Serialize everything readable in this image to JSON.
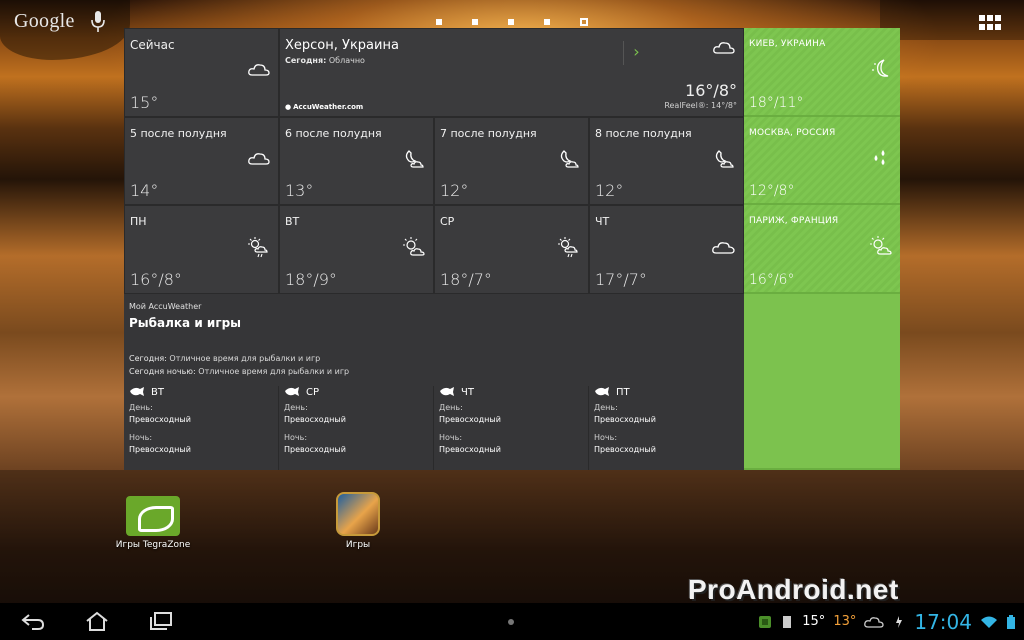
{
  "top_bar": {
    "search_logo": "Google",
    "page_count": 5,
    "active_page": 5
  },
  "colors": {
    "tile_dark": "#3b3b3d",
    "tile_green": "#7cc24e",
    "clock_blue": "#33b5e5",
    "tray_temp_orange": "#f2a03a"
  },
  "current": {
    "label": "Сейчас",
    "temp": "15°",
    "icon": "cloud-icon",
    "city": "Херсон, Украина",
    "today_label": "Сегодня:",
    "today_condition": "Облачно",
    "brand": "AccuWeather.com",
    "hi_lo": "16°/8°",
    "realfeel": "RealFeel®: 14°/8°",
    "arrow": "›"
  },
  "cities": [
    {
      "name": "КИЕВ, УКРАИНА",
      "temp": "18°/11°",
      "icon": "moon-icon"
    },
    {
      "name": "МОСКВА, РОССИЯ",
      "temp": "12°/8°",
      "icon": "rain-drops-icon"
    },
    {
      "name": "ПАРИЖ, ФРАНЦИЯ",
      "temp": "16°/6°",
      "icon": "partly-sunny-icon"
    }
  ],
  "hourly": [
    {
      "label": "5 после полудня",
      "temp": "14°",
      "icon": "cloud-icon"
    },
    {
      "label": "6 после полудня",
      "temp": "13°",
      "icon": "moon-cloud-icon"
    },
    {
      "label": "7 после полудня",
      "temp": "12°",
      "icon": "moon-cloud-icon"
    },
    {
      "label": "8 после полудня",
      "temp": "12°",
      "icon": "moon-cloud-icon"
    }
  ],
  "daily": [
    {
      "label": "ПН",
      "temp": "16°/8°",
      "icon": "sun-cloud-rain-icon"
    },
    {
      "label": "ВТ",
      "temp": "18°/9°",
      "icon": "sun-cloud-icon"
    },
    {
      "label": "СР",
      "temp": "18°/7°",
      "icon": "sun-cloud-rain-icon"
    },
    {
      "label": "ЧТ",
      "temp": "17°/7°",
      "icon": "cloud-icon"
    }
  ],
  "my_accu": {
    "subtitle": "Мой AccuWeather",
    "title": "Рыбалка и игры",
    "today_label": "Сегодня:",
    "today_text": "Отличное время для рыбалки и игр",
    "tonight_label": "Сегодня ночью:",
    "tonight_text": "Отличное время для рыбалки и игр",
    "days": [
      {
        "day": "ВТ",
        "day_label": "День:",
        "day_value": "Превосходный",
        "night_label": "Ночь:",
        "night_value": "Превосходный"
      },
      {
        "day": "СР",
        "day_label": "День:",
        "day_value": "Превосходный",
        "night_label": "Ночь:",
        "night_value": "Превосходный"
      },
      {
        "day": "ЧТ",
        "day_label": "День:",
        "day_value": "Превосходный",
        "night_label": "Ночь:",
        "night_value": "Превосходный"
      },
      {
        "day": "ПТ",
        "day_label": "День:",
        "day_value": "Превосходный",
        "night_label": "Ночь:",
        "night_value": "Превосходный"
      }
    ]
  },
  "desktop_apps": [
    {
      "label": "Игры TegraZone",
      "icon": "nvidia-tegrazone-icon"
    },
    {
      "label": "Игры",
      "icon": "games-icon"
    }
  ],
  "watermark": "ProAndroid.net",
  "system_bar": {
    "temp_now": "15°",
    "temp_alt": "13°",
    "clock": "17:04"
  }
}
